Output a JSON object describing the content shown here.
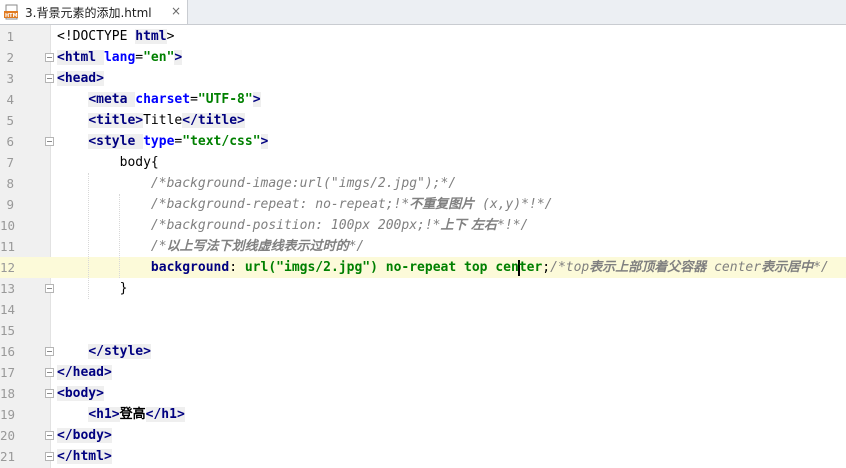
{
  "tab": {
    "title": "3.背景元素的添加.html",
    "close": "×",
    "icon": "html-file-icon"
  },
  "lines": [
    {
      "n": "1",
      "parts": [
        [
          "tx",
          "<!DOCTYPE "
        ],
        [
          "tag",
          "html"
        ],
        [
          "tx",
          ">"
        ]
      ]
    },
    {
      "n": "2",
      "parts": [
        [
          "tag",
          "<html "
        ],
        [
          "attr",
          "lang"
        ],
        [
          "tx",
          "="
        ],
        [
          "str",
          "\"en\""
        ],
        [
          "tag",
          ">"
        ]
      ]
    },
    {
      "n": "3",
      "parts": [
        [
          "tag",
          "<head>"
        ]
      ]
    },
    {
      "n": "4",
      "parts": [
        [
          "tx",
          "    "
        ],
        [
          "tag",
          "<meta "
        ],
        [
          "attr",
          "charset"
        ],
        [
          "tx",
          "="
        ],
        [
          "str",
          "\"UTF-8\""
        ],
        [
          "tag",
          ">"
        ]
      ]
    },
    {
      "n": "5",
      "parts": [
        [
          "tx",
          "    "
        ],
        [
          "tag",
          "<title>"
        ],
        [
          "tx",
          "Title"
        ],
        [
          "tag",
          "</title>"
        ]
      ]
    },
    {
      "n": "6",
      "parts": [
        [
          "tx",
          "    "
        ],
        [
          "tag",
          "<style "
        ],
        [
          "attr",
          "type"
        ],
        [
          "tx",
          "="
        ],
        [
          "str",
          "\"text/css\""
        ],
        [
          "tag",
          ">"
        ]
      ]
    },
    {
      "n": "7",
      "parts": [
        [
          "tx",
          "        "
        ],
        [
          "tx",
          "body{"
        ]
      ]
    },
    {
      "n": "8",
      "parts": [
        [
          "tx",
          "            "
        ],
        [
          "cm",
          "/*background-image:url(\"imgs/2.jpg\");*/"
        ]
      ]
    },
    {
      "n": "9",
      "parts": [
        [
          "tx",
          "            "
        ],
        [
          "cm",
          "/*background-repeat: no-repeat;!*"
        ],
        [
          "cmcn",
          "不重复图片"
        ],
        [
          "cm",
          " (x,y)*!*/"
        ]
      ]
    },
    {
      "n": "10",
      "parts": [
        [
          "tx",
          "            "
        ],
        [
          "cm",
          "/*background-position: 100px 200px;!*"
        ],
        [
          "cmcn",
          "上下 左右"
        ],
        [
          "cm",
          "*!*/"
        ]
      ]
    },
    {
      "n": "11",
      "parts": [
        [
          "tx",
          "            "
        ],
        [
          "cm",
          "/*"
        ],
        [
          "cmcn",
          "以上写法下划线虚线表示过时的"
        ],
        [
          "cm",
          "*/"
        ]
      ]
    },
    {
      "n": "12",
      "current": true,
      "parts": [
        [
          "tx",
          "            "
        ],
        [
          "prop",
          "background"
        ],
        [
          "tx",
          ": "
        ],
        [
          "kw",
          "url("
        ],
        [
          "str",
          "\"imgs/2.jpg\""
        ],
        [
          "kw",
          ")"
        ],
        [
          "tx",
          " "
        ],
        [
          "kw",
          "no-repeat top cen"
        ],
        [
          "caret",
          ""
        ],
        [
          "kw",
          "ter"
        ],
        [
          "tx",
          ";"
        ],
        [
          "cm",
          "/*top"
        ],
        [
          "cmcn",
          "表示上部顶着父容器"
        ],
        [
          "cm",
          " center"
        ],
        [
          "cmcn",
          "表示居中"
        ],
        [
          "cm",
          "*/"
        ]
      ]
    },
    {
      "n": "13",
      "parts": [
        [
          "tx",
          "        }"
        ]
      ]
    },
    {
      "n": "14",
      "parts": []
    },
    {
      "n": "15",
      "parts": []
    },
    {
      "n": "16",
      "parts": [
        [
          "tx",
          "    "
        ],
        [
          "tag",
          "</style>"
        ]
      ]
    },
    {
      "n": "17",
      "parts": [
        [
          "tag",
          "</head>"
        ]
      ]
    },
    {
      "n": "18",
      "parts": [
        [
          "tag",
          "<body>"
        ]
      ]
    },
    {
      "n": "19",
      "parts": [
        [
          "tx",
          "    "
        ],
        [
          "tag",
          "<h1>"
        ],
        [
          "cmb",
          "登高"
        ],
        [
          "tag",
          "</h1>"
        ]
      ]
    },
    {
      "n": "20",
      "parts": [
        [
          "tag",
          "</body>"
        ]
      ]
    },
    {
      "n": "21",
      "parts": [
        [
          "tag",
          "</html>"
        ]
      ]
    }
  ],
  "fold_lines": [
    "2",
    "3",
    "6",
    "13",
    "16",
    "17",
    "18",
    "20",
    "21"
  ],
  "colors": {
    "tag": "#000080",
    "attr": "#0000ff",
    "string": "#008000",
    "comment": "#808080",
    "current_line": "#fcfad9",
    "gutter": "#f0f0f0"
  }
}
